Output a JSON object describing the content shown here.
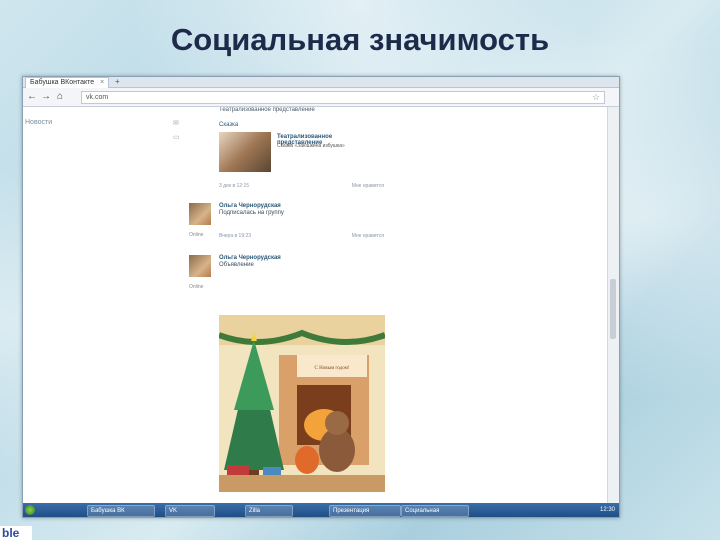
{
  "slide": {
    "title": "Социальная значимость"
  },
  "browser": {
    "tab_label": "Бабушка ВКонтакте",
    "url": "vk.com",
    "left_menu_item": "Новости"
  },
  "feed": {
    "top_lines": [
      "Театрализованное представление"
    ],
    "card_label": "Сказка",
    "card_title": "Театрализованное представление",
    "card_desc": "Сказка «Заюшкина избушка»",
    "meta_left": "3 дек в 12:15",
    "meta_right": "Мне нравится"
  },
  "posts": [
    {
      "author": "Ольга Чернорудская",
      "text": "Подписалась на группу",
      "online": "Online",
      "meta_left": "Вчера в 19:23",
      "meta_right": "Мне нравится"
    },
    {
      "author": "Ольга Чернорудская",
      "text": "Объявление",
      "online": "Online",
      "meta_left": "3 дек в 12:15",
      "meta_right": "Мне нравится"
    }
  ],
  "xmas_card": {
    "caption": "С Новым годом!"
  },
  "taskbar": {
    "items": [
      "Бабушка ВК",
      "VK",
      "Zilla",
      "Презентация",
      "Социальная"
    ],
    "clock": "12:30"
  },
  "corner_text": "ble"
}
